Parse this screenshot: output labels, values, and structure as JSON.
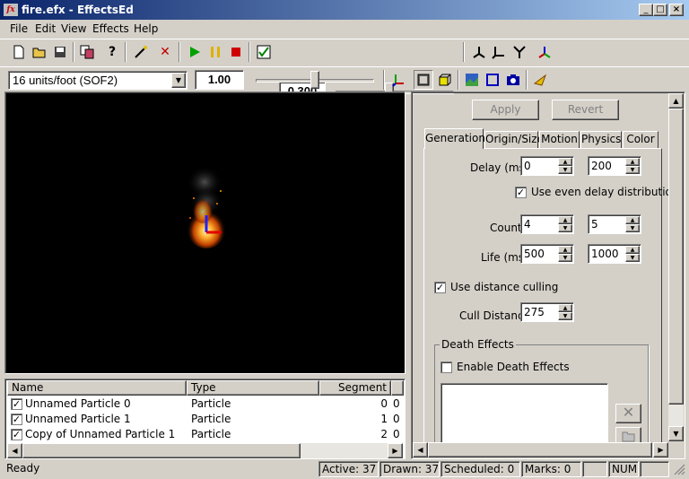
{
  "window": {
    "title": "fire.efx - EffectsEd",
    "icon_text": "fx",
    "minimize": "_",
    "maximize": "□",
    "close": "×"
  },
  "menu": {
    "file": "File",
    "edit": "Edit",
    "view": "View",
    "effects": "Effects",
    "help": "Help"
  },
  "toolbar1": {
    "speed_value": "0.300",
    "speed_slider_level": 0.45
  },
  "toolbar2": {
    "units_select": "16 units/foot (SOF2)",
    "scale_value": "1.00",
    "scale_slider_level": 0.5
  },
  "particle_list": {
    "columns": [
      "Name",
      "Type",
      "Segment"
    ],
    "rows": [
      {
        "name": "Unnamed Particle 0",
        "type": "Particle",
        "segment": "0",
        "extra": "0",
        "checked": true
      },
      {
        "name": "Unnamed Particle 1",
        "type": "Particle",
        "segment": "1",
        "extra": "0",
        "checked": true
      },
      {
        "name": "Copy of Unnamed Particle 1",
        "type": "Particle",
        "segment": "2",
        "extra": "0",
        "checked": true
      }
    ]
  },
  "panel": {
    "apply": "Apply",
    "revert": "Revert",
    "tabs": [
      "Generation",
      "Origin/Size",
      "Motion",
      "Physics",
      "Color"
    ],
    "active_tab": "Generation",
    "delay_label": "Delay (ms)",
    "delay_min": "0",
    "delay_max": "200",
    "even_delay_label": "Use even delay distribution",
    "even_delay_checked": true,
    "count_label": "Count",
    "count_min": "4",
    "count_max": "5",
    "life_label": "Life (ms)",
    "life_min": "500",
    "life_max": "1000",
    "distance_culling_label": "Use distance culling",
    "distance_culling_checked": true,
    "cull_distance_label": "Cull Distance",
    "cull_distance": "275",
    "death_effects_group": "Death Effects",
    "enable_death_label": "Enable Death Effects",
    "enable_death_checked": false
  },
  "status": {
    "ready": "Ready",
    "active": "Active: 37",
    "drawn": "Drawn: 37",
    "scheduled": "Scheduled: 0",
    "marks": "Marks: 0",
    "num": "NUM"
  },
  "colors": {
    "titlebar_start": "#0a246a",
    "titlebar_end": "#a6caf0",
    "face": "#d4d0c8",
    "viewport": "#000000"
  }
}
